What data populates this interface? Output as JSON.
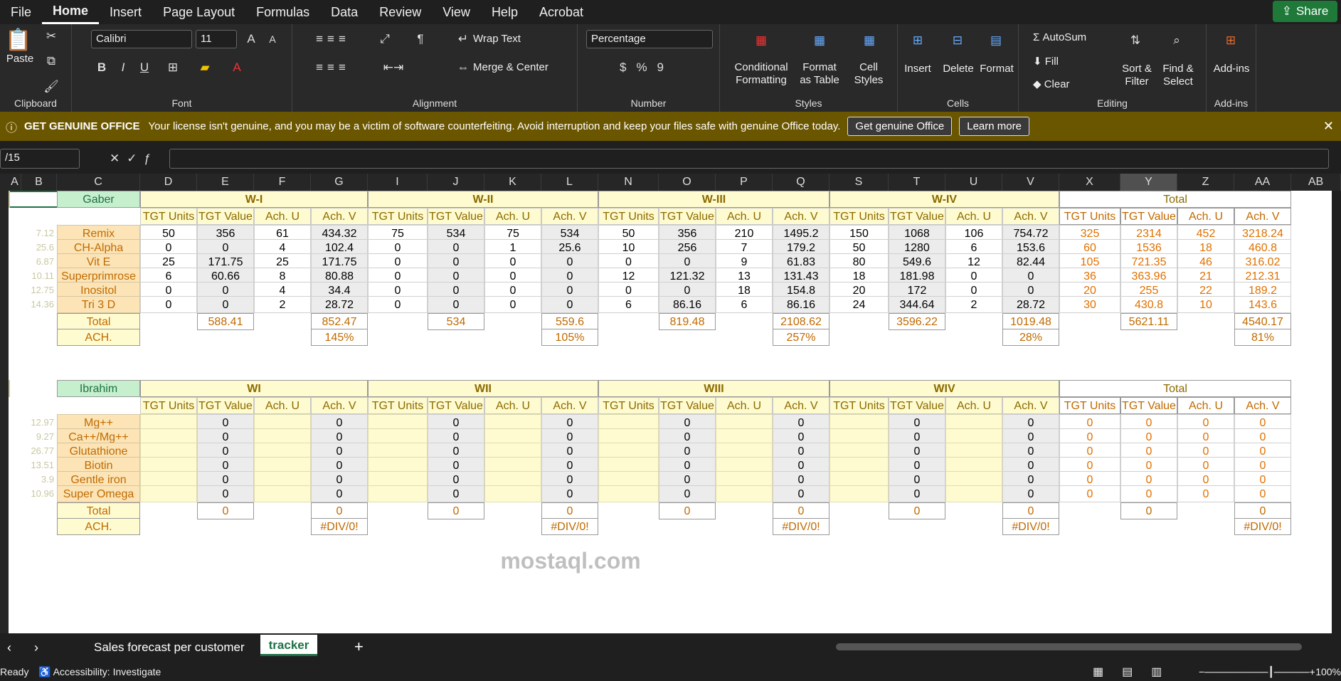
{
  "menu": [
    "File",
    "Home",
    "Insert",
    "Page Layout",
    "Formulas",
    "Data",
    "Review",
    "View",
    "Help",
    "Acrobat"
  ],
  "share": "Share",
  "ribbon": {
    "paste": "Paste",
    "clipboard": "Clipboard",
    "font_name": "Calibri",
    "font_size": "11",
    "font": "Font",
    "wrap": "Wrap Text",
    "merge": "Merge & Center",
    "alignment": "Alignment",
    "numfmt": "Percentage",
    "number": "Number",
    "cond": "Conditional Formatting",
    "fmt_table": "Format as Table",
    "cell_styles": "Cell Styles",
    "styles": "Styles",
    "insert": "Insert",
    "delete": "Delete",
    "format": "Format",
    "cells": "Cells",
    "autosum": "AutoSum",
    "fill": "Fill",
    "clear": "Clear",
    "sort": "Sort & Filter",
    "find": "Find & Select",
    "editing": "Editing",
    "addins": "Add-ins",
    "addins_grp": "Add-ins"
  },
  "banner": {
    "title": "GET GENUINE OFFICE",
    "msg": "Your license isn't genuine, and you may be a victim of software counterfeiting. Avoid interruption and keep your files safe with genuine Office today.",
    "btn1": "Get genuine Office",
    "btn2": "Learn more"
  },
  "namebox": "/15",
  "columns": [
    "A",
    "B",
    "C",
    "D",
    "E",
    "F",
    "G",
    "I",
    "J",
    "K",
    "L",
    "N",
    "O",
    "P",
    "Q",
    "S",
    "T",
    "U",
    "V",
    "X",
    "Y",
    "Z",
    "AA",
    "AB"
  ],
  "gaber": {
    "name": "Gaber",
    "weeks": [
      "W-I",
      "W-II",
      "W-III",
      "W-IV",
      "Total"
    ],
    "subheads": [
      "TGT Units",
      "TGT Value",
      "Ach. U",
      "Ach. V"
    ],
    "rows": [
      {
        "p": "7.12",
        "n": "Remix",
        "v": [
          "50",
          "356",
          "61",
          "434.32",
          "75",
          "534",
          "75",
          "534",
          "50",
          "356",
          "210",
          "1495.2",
          "150",
          "1068",
          "106",
          "754.72",
          "325",
          "2314",
          "452",
          "3218.24"
        ]
      },
      {
        "p": "25.6",
        "n": "CH-Alpha",
        "v": [
          "0",
          "0",
          "4",
          "102.4",
          "0",
          "0",
          "1",
          "25.6",
          "10",
          "256",
          "7",
          "179.2",
          "50",
          "1280",
          "6",
          "153.6",
          "60",
          "1536",
          "18",
          "460.8"
        ]
      },
      {
        "p": "6.87",
        "n": "Vit E",
        "v": [
          "25",
          "171.75",
          "25",
          "171.75",
          "0",
          "0",
          "0",
          "0",
          "0",
          "0",
          "9",
          "61.83",
          "80",
          "549.6",
          "12",
          "82.44",
          "105",
          "721.35",
          "46",
          "316.02"
        ]
      },
      {
        "p": "10.11",
        "n": "Superprimrose",
        "v": [
          "6",
          "60.66",
          "8",
          "80.88",
          "0",
          "0",
          "0",
          "0",
          "12",
          "121.32",
          "13",
          "131.43",
          "18",
          "181.98",
          "0",
          "0",
          "36",
          "363.96",
          "21",
          "212.31"
        ]
      },
      {
        "p": "12.75",
        "n": "Inositol",
        "v": [
          "0",
          "0",
          "4",
          "34.4",
          "0",
          "0",
          "0",
          "0",
          "0",
          "0",
          "18",
          "154.8",
          "20",
          "172",
          "0",
          "0",
          "20",
          "255",
          "22",
          "189.2"
        ]
      },
      {
        "p": "14.36",
        "n": "Tri 3 D",
        "v": [
          "0",
          "0",
          "2",
          "28.72",
          "0",
          "0",
          "0",
          "0",
          "6",
          "86.16",
          "6",
          "86.16",
          "24",
          "344.64",
          "2",
          "28.72",
          "30",
          "430.8",
          "10",
          "143.6"
        ]
      }
    ],
    "total_label": "Total",
    "ach_label": "ACH.",
    "totals": [
      "588.41",
      "852.47",
      "534",
      "559.6",
      "819.48",
      "2108.62",
      "3596.22",
      "1019.48",
      "5621.11",
      "4540.17"
    ],
    "ach": [
      "145%",
      "105%",
      "257%",
      "28%",
      "81%"
    ]
  },
  "ibrahim": {
    "name": "Ibrahim",
    "weeks": [
      "WI",
      "WII",
      "WIII",
      "WIV",
      "Total"
    ],
    "rows": [
      {
        "p": "12.97",
        "n": "Mg++"
      },
      {
        "p": "9.27",
        "n": "Ca++/Mg++"
      },
      {
        "p": "26.77",
        "n": "Glutathione"
      },
      {
        "p": "13.51",
        "n": "Biotin"
      },
      {
        "p": "3.9",
        "n": "Gentle iron"
      },
      {
        "p": "10.96",
        "n": "Super Omega"
      }
    ],
    "zero": "0",
    "div": "#DIV/0!"
  },
  "sheets": [
    "Sales forecast per customer",
    "tracker"
  ],
  "status": {
    "ready": "Ready",
    "access": "Accessibility: Investigate",
    "zoom": "100%"
  },
  "watermark": "mostaql.com"
}
